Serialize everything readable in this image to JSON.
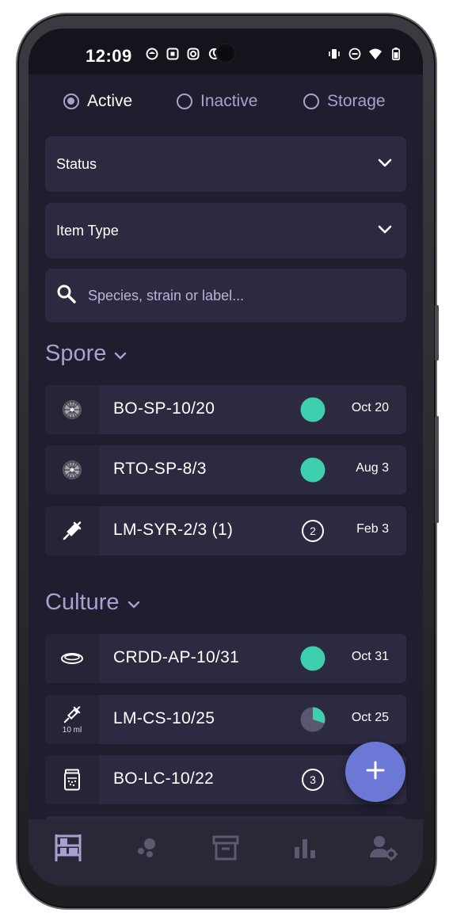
{
  "status_bar": {
    "time": "12:09",
    "left_icons": [
      "mushroom-app-icon",
      "square-app-icon",
      "instagram-icon",
      "moon-icon"
    ],
    "right_icons": [
      "vibrate-icon",
      "dnd-icon",
      "wifi-icon",
      "battery-icon"
    ]
  },
  "filters": {
    "radios": [
      {
        "label": "Active",
        "selected": true
      },
      {
        "label": "Inactive",
        "selected": false
      },
      {
        "label": "Storage",
        "selected": false
      }
    ],
    "status_label": "Status",
    "item_type_label": "Item Type",
    "search_placeholder": "Species, strain or label..."
  },
  "sections": {
    "spore": {
      "title": "Spore",
      "items": [
        {
          "icon": "spore-print-icon",
          "label": "BO-SP-10/20",
          "status": "full-dot",
          "date": "Oct 20"
        },
        {
          "icon": "spore-print-icon",
          "label": "RTO-SP-8/3",
          "status": "full-dot",
          "date": "Aug 3"
        },
        {
          "icon": "syringe-icon",
          "label": "LM-SYR-2/3 (1)",
          "status": "count",
          "count": "2",
          "date": "Feb 3"
        }
      ]
    },
    "culture": {
      "title": "Culture",
      "items": [
        {
          "icon": "petri-dish-icon",
          "label": "CRDD-AP-10/31",
          "status": "full-dot",
          "date": "Oct 31"
        },
        {
          "icon": "syringe-icon",
          "icon_sub": "10 ml",
          "label": "LM-CS-10/25",
          "status": "partial-dot",
          "fill_fraction": 0.3,
          "date": "Oct 25"
        },
        {
          "icon": "jar-icon",
          "label": "BO-LC-10/22",
          "status": "count",
          "count": "3",
          "date": ""
        }
      ]
    }
  },
  "colors": {
    "background": "#1f1d2e",
    "card": "#2c2a40",
    "accent": "#a7a1cf",
    "status_green": "#3ecfae",
    "fab": "#6c78d6"
  },
  "bottom_nav": [
    "shelves-icon",
    "spores-icon",
    "archive-icon",
    "bar-chart-icon",
    "user-settings-icon"
  ]
}
